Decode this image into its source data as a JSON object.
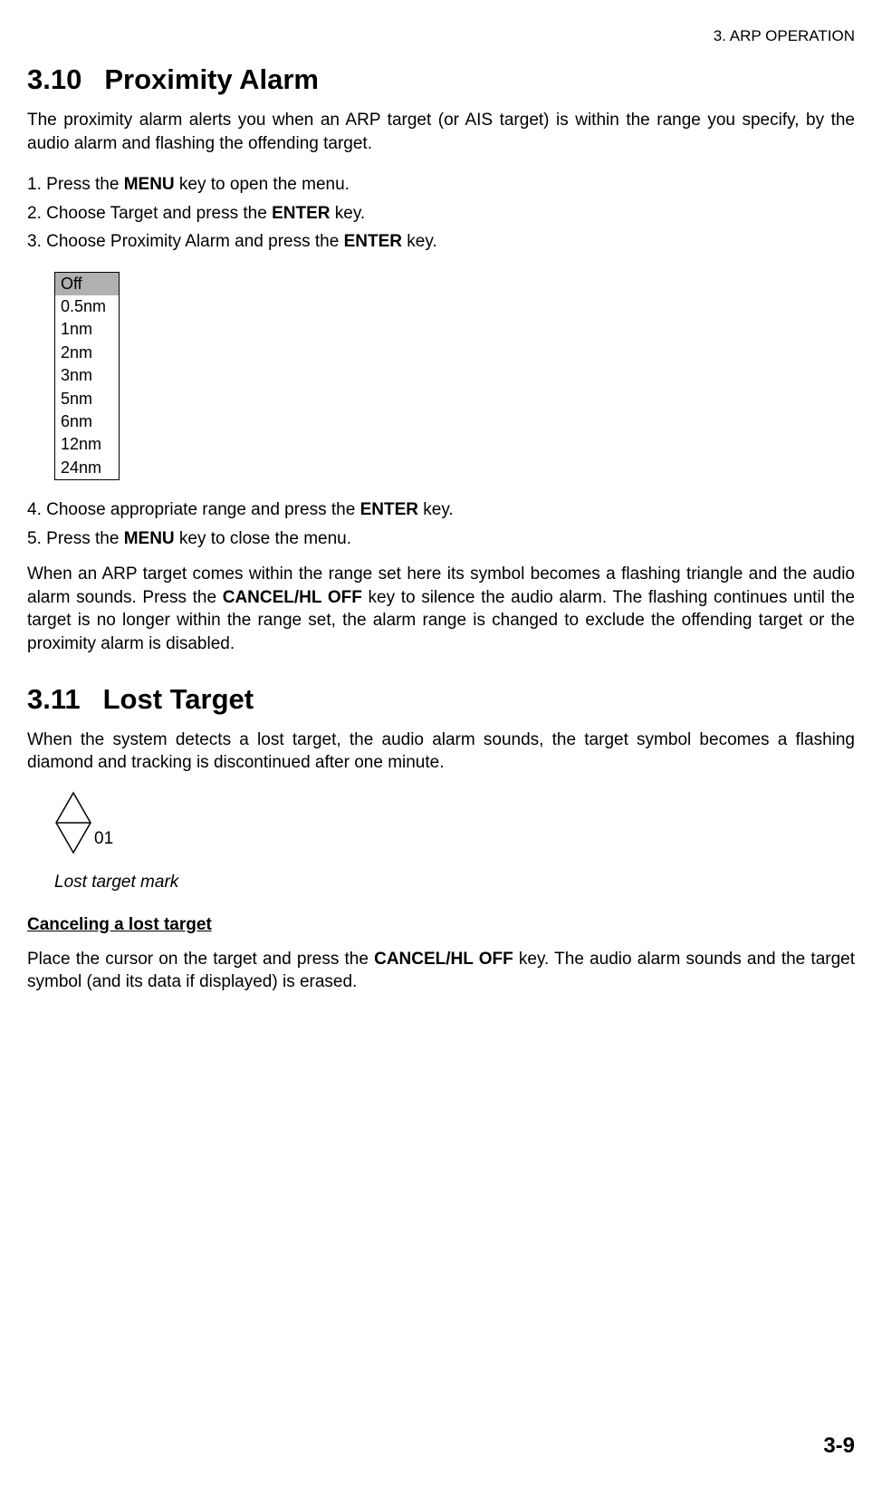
{
  "header": {
    "chapter": "3. ARP OPERATION"
  },
  "section310": {
    "number": "3.10",
    "title": "Proximity Alarm",
    "intro": "The proximity alarm alerts you when an ARP target (or AIS target) is within the range you specify, by the audio alarm and flashing the offending target.",
    "steps1": [
      {
        "num": "1.",
        "prefix": "Press the ",
        "bold": "MENU",
        "suffix": " key to open the menu."
      },
      {
        "num": "2.",
        "prefix": "Choose Target and press the ",
        "bold": "ENTER",
        "suffix": " key."
      },
      {
        "num": "3.",
        "prefix": "Choose Proximity Alarm and press the ",
        "bold": "ENTER",
        "suffix": " key."
      }
    ],
    "menu_options": [
      "Off",
      "0.5nm",
      "1nm",
      "2nm",
      "3nm",
      "5nm",
      "6nm",
      "12nm",
      "24nm"
    ],
    "steps2": [
      {
        "num": "4.",
        "prefix": "Choose appropriate range and press the ",
        "bold": "ENTER",
        "suffix": " key."
      },
      {
        "num": "5.",
        "prefix": "Press the ",
        "bold": "MENU",
        "suffix": " key to close the menu."
      }
    ],
    "body_part1": "When an ARP target comes within the range set here its symbol becomes a flashing triangle and the audio alarm sounds. Press the ",
    "body_bold": "CANCEL/HL OFF",
    "body_part2": " key to silence the audio alarm. The flashing continues until the target is no longer within the range set, the alarm range is changed to exclude the offending target or the proximity alarm is disabled."
  },
  "section311": {
    "number": "3.11",
    "title": "Lost Target",
    "intro": "When the system detects a lost target, the audio alarm sounds, the target symbol becomes a flashing diamond and tracking is discontinued after one minute.",
    "diamond_label": "01",
    "caption": "Lost target mark",
    "sub_heading": "Canceling a lost target",
    "cancel_part1": "Place the cursor on the target and press the ",
    "cancel_bold": "CANCEL/HL OFF",
    "cancel_part2": " key. The audio alarm sounds and the target symbol (and its data if displayed) is erased."
  },
  "page_number": "3-9"
}
